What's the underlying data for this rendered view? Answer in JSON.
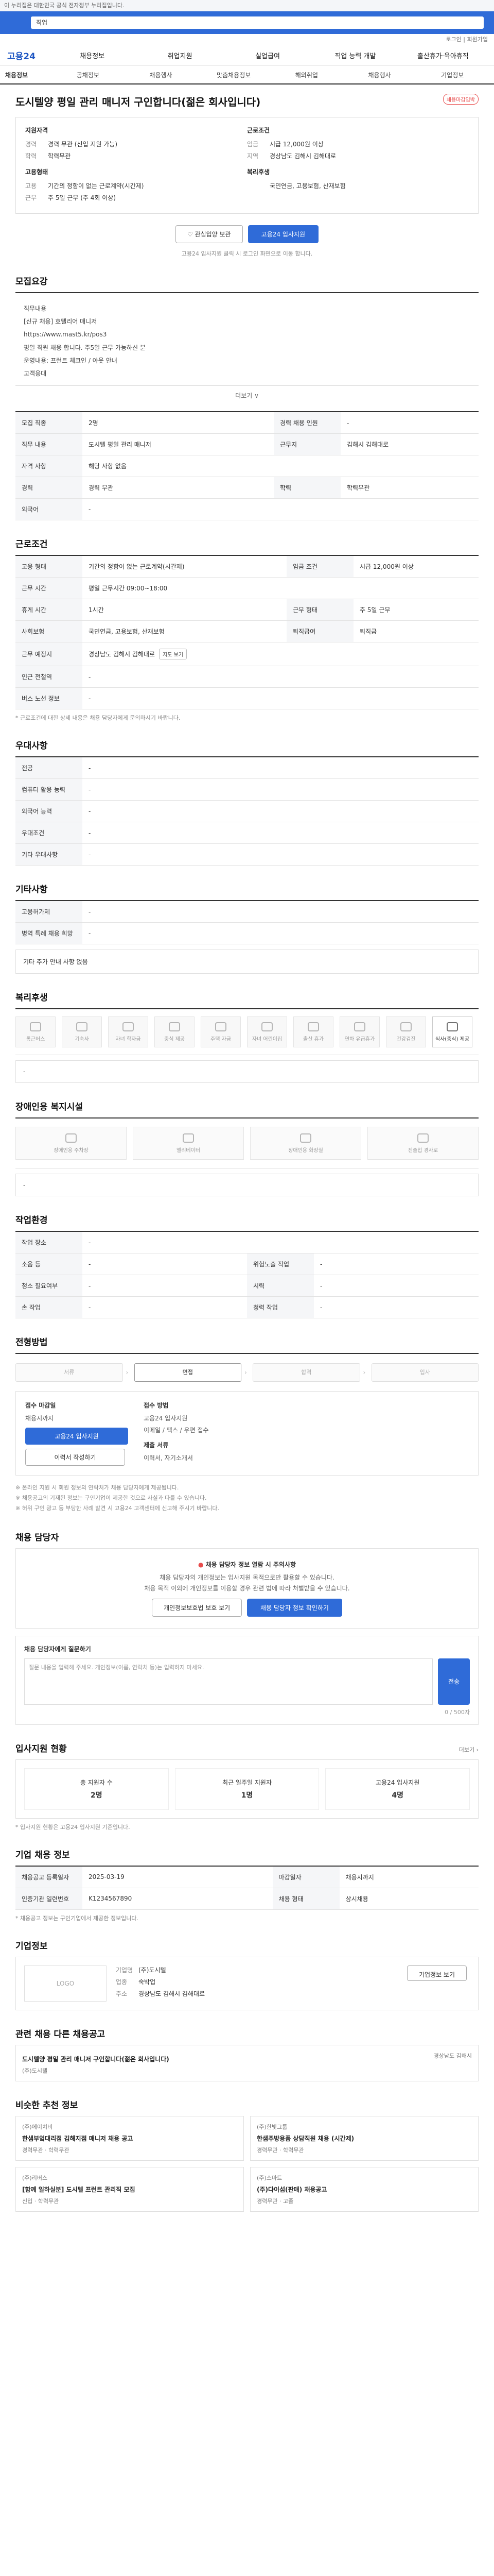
{
  "gov_banner": "이 누리집은 대한민국 공식 전자정부 누리집입니다.",
  "search": {
    "placeholder": "직업"
  },
  "top_links": [
    "로그인",
    "회원가입"
  ],
  "header": {
    "logo": "고용24",
    "gnb": [
      "채용정보",
      "취업지원",
      "실업급여",
      "직업 능력 개발",
      "출산휴가·육아휴직"
    ]
  },
  "subnav": {
    "crumb": "채용정보",
    "items": [
      "공채정보",
      "채용행사",
      "맞춤채용정보",
      "해외취업",
      "채용행사",
      "기업정보"
    ]
  },
  "job": {
    "title": "도시텔양 평일 관리 매니저 구인합니다(젊은 회사입니다)",
    "badge": "채용마감임박",
    "summary": {
      "left_title": "지원자격",
      "left": [
        [
          "경력",
          "경력 무관 (신입 지원 가능)"
        ],
        [
          "학력",
          "학력무관"
        ]
      ],
      "left_title2": "고용형태",
      "left2": [
        [
          "고용",
          "기간의 정함이 없는 근로계약(시간제)"
        ],
        [
          "근무",
          "주 5일 근무 (주 4회 이상)"
        ]
      ],
      "right_title": "근로조건",
      "right": [
        [
          "임금",
          "시급 12,000원 이상"
        ],
        [
          "지역",
          "경상남도 김해시 김해대로"
        ]
      ],
      "right_title2": "복리후생",
      "right2": [
        [
          "",
          "국민연금, 고용보험, 산재보험"
        ]
      ]
    },
    "btn_scrap": "관심입양 보관",
    "btn_apply": "고용24 입사지원",
    "apply_note": "고용24 입사지원 클릭 시 로그인 화면으로 이동 합니다."
  },
  "sections": {
    "recruit": "모집요강",
    "conditions": "근로조건",
    "preferences": "우대사항",
    "etc": "기타사항",
    "welfare": "복리후생",
    "disabled": "장애인용 복지시설",
    "env": "작업환경",
    "process": "전형방법",
    "contact": "채용 담당자",
    "stats": "입사지원 현황",
    "info": "기업 채용 정보",
    "company": "기업정보",
    "related": "관련 채용 다른 채용공고",
    "similar": "비슷한 추천 정보"
  },
  "recruit_desc": [
    "직무내용",
    "[신규 채용] 호텔리어 매니저",
    "https://www.mast5.kr/pos3",
    "평일 직원 채용 합니다. 주5일 근무 가능하신 분",
    "운영내용: 프런트 체크인 / 아웃 안내",
    "고객응대"
  ],
  "more": "더보기 ∨",
  "recruit_table": [
    [
      "모집 직종",
      "2명",
      "경력 채용 인원",
      "-"
    ],
    [
      "직무 내용",
      "도시텔 평일 관리 매니저",
      "근무지",
      "김해시 김해대로"
    ],
    [
      "자격 사항",
      "해당 사항 없음",
      "",
      ""
    ],
    [
      "경력",
      "경력 무관",
      "학력",
      "학력무관"
    ],
    [
      "외국어",
      "-",
      "",
      ""
    ]
  ],
  "cond_table": [
    [
      "고용 형태",
      "기간의 정함이 없는 근로계약(시간제)",
      "임금 조건",
      "시급 12,000원 이상"
    ],
    [
      "근무 시간",
      "평일 근무시간 09:00~18:00",
      "",
      ""
    ],
    [
      "휴게 시간",
      "1시간",
      "근무 형태",
      "주 5일 근무"
    ],
    [
      "사회보험",
      "국민연금, 고용보험, 산재보험",
      "퇴직급여",
      "퇴직금"
    ],
    [
      "근무 예정지",
      "경상남도 김해시 김해대로",
      "",
      ""
    ],
    [
      "인근 전철역",
      "-",
      "",
      ""
    ],
    [
      "버스 노선 정보",
      "-",
      "",
      ""
    ]
  ],
  "cond_note": "* 근로조건에 대한 상세 내용은 채용 담당자에게 문의하시기 바랍니다.",
  "pref_table": [
    [
      "전공",
      "-"
    ],
    [
      "컴퓨터 활용 능력",
      "-"
    ],
    [
      "외국어 능력",
      "-"
    ],
    [
      "우대조건",
      "-"
    ],
    [
      "기타 우대사항",
      "-"
    ]
  ],
  "etc_table": [
    [
      "고용허가제",
      "-"
    ],
    [
      "병역 특례 채용 희망",
      "-"
    ]
  ],
  "etc_box": "기타 추가 안내 사항 없음",
  "welfare_items": [
    "통근버스",
    "기숙사",
    "자녀 학자금",
    "중식 제공",
    "주택 자금",
    "자녀 어린이집",
    "출산 휴가",
    "연차 유급휴가",
    "건강검진",
    "식사(중식) 제공"
  ],
  "welfare_box": "-",
  "disabled_items": [
    "장애인용 주차장",
    "엘리베이터",
    "장애인용 화장실",
    "진출입 경사로"
  ],
  "disabled_box": "-",
  "env_table": [
    [
      "작업 장소",
      "-",
      "",
      ""
    ],
    [
      "소음 등",
      "-",
      "위험노출 작업",
      "-"
    ],
    [
      "청소 필요여부",
      "-",
      "시력",
      "-"
    ],
    [
      "손 작업",
      "-",
      "청력 작업",
      "-"
    ]
  ],
  "process_steps": [
    "서류",
    "면접",
    "합격",
    "입사"
  ],
  "apply": {
    "h1": "접수 마감일",
    "deadline": "채용시까지",
    "btn": "고용24 입사지원",
    "btn2": "이력서 작성하기",
    "h2": "접수 방법",
    "methods": [
      "고용24 입사지원",
      "이메일 / 팩스 / 우편 접수"
    ],
    "h3": "제출 서류",
    "docs": [
      "이력서, 자기소개서"
    ]
  },
  "process_notes": [
    "※ 온라인 지원 시 회원 정보의 연락처가 채용 담당자에게 제공됩니다.",
    "※ 채용공고의 기재된 정보는 구인기업이 제공한 것으로 사실과 다를 수 있습니다.",
    "※ 허위 구인 광고 등 부당한 사례 발견 시 고용24 고객센터에 신고해 주시기 바랍니다."
  ],
  "contact": {
    "warn": "채용 담당자 정보 열람 시 주의사항",
    "lines": [
      "채용 담당자의 개인정보는 입사지원 목적으로만 활용할 수 있습니다.",
      "채용 목적 이외에 개인정보를 이용할 경우 관련 법에 따라 처벌받을 수 있습니다."
    ],
    "btn_a": "개인정보보호법 보호 보기",
    "btn_b": "채용 담당자 정보 확인하기"
  },
  "qa": {
    "title": "채용 담당자에게 질문하기",
    "placeholder": "질문 내용을 입력해 주세요. 개인정보(이름, 연락처 등)는 입력하지 마세요.",
    "btn": "전송",
    "counter": "0 / 500자"
  },
  "stats": [
    {
      "label": "총 지원자 수",
      "value": "2명"
    },
    {
      "label": "최근 일주일 지원자",
      "value": "1명"
    },
    {
      "label": "고용24 입사지원",
      "value": "4명"
    }
  ],
  "stats_note": "* 입사지원 현황은 고용24 입사지원 기준입니다.",
  "info_table": [
    [
      "채용공고 등록일자",
      "2025-03-19",
      "마감일자",
      "채용시까지"
    ],
    [
      "인증기관 일련번호",
      "K1234567890",
      "채용 형태",
      "상시채용"
    ]
  ],
  "info_note": "* 채용공고 정보는 구인기업에서 제공한 정보입니다.",
  "company": {
    "logo": "LOGO",
    "rows": [
      [
        "기업명",
        "(주)도시텔"
      ],
      [
        "업종",
        "숙박업"
      ],
      [
        "주소",
        "경상남도 김해시 김해대로"
      ]
    ],
    "btn": "기업정보 보기"
  },
  "related": {
    "title": "도시텔양 평일 관리 매니저 구인합니다(젊은 회사입니다)",
    "company": "(주)도시텔",
    "place": "경상남도 김해시"
  },
  "recs": [
    {
      "co": "(주)에이치비",
      "ti": "한샘부엌대리점 김해지점 매니저 채용 공고",
      "meta": "경력무관 · 학력무관"
    },
    {
      "co": "(주)한빛그룹",
      "ti": "한샘주방용품 상담직원 채용 (시간제)",
      "meta": "경력무관 · 학력무관"
    },
    {
      "co": "(주)리버스",
      "ti": "[함께 일하실분] 도시텔 프런트 관리직 모집",
      "meta": "신입 · 학력무관"
    },
    {
      "co": "(주)스마트",
      "ti": "(주)다이섬(판매) 채용공고",
      "meta": "경력무관 · 고졸"
    }
  ]
}
